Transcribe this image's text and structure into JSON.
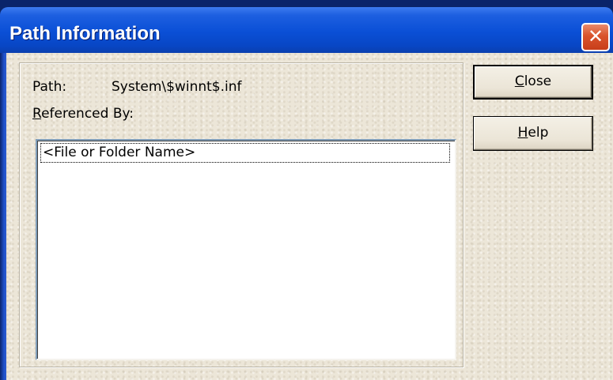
{
  "window": {
    "title": "Path Information",
    "close_glyph": "✕"
  },
  "path": {
    "label": "Path:",
    "value": "System\\$winnt$.inf"
  },
  "referenced_by": {
    "label_first": "R",
    "label_rest": "eferenced By:",
    "items": [
      "<File or Folder Name>"
    ]
  },
  "buttons": {
    "close_first": "C",
    "close_rest": "lose",
    "help_first": "H",
    "help_rest": "elp"
  },
  "colors": {
    "titlebar": "#0a4fd6",
    "dialog_bg": "#ece6d8",
    "close_button": "#d9532c"
  },
  "icons": {
    "title_close": "close-icon"
  }
}
